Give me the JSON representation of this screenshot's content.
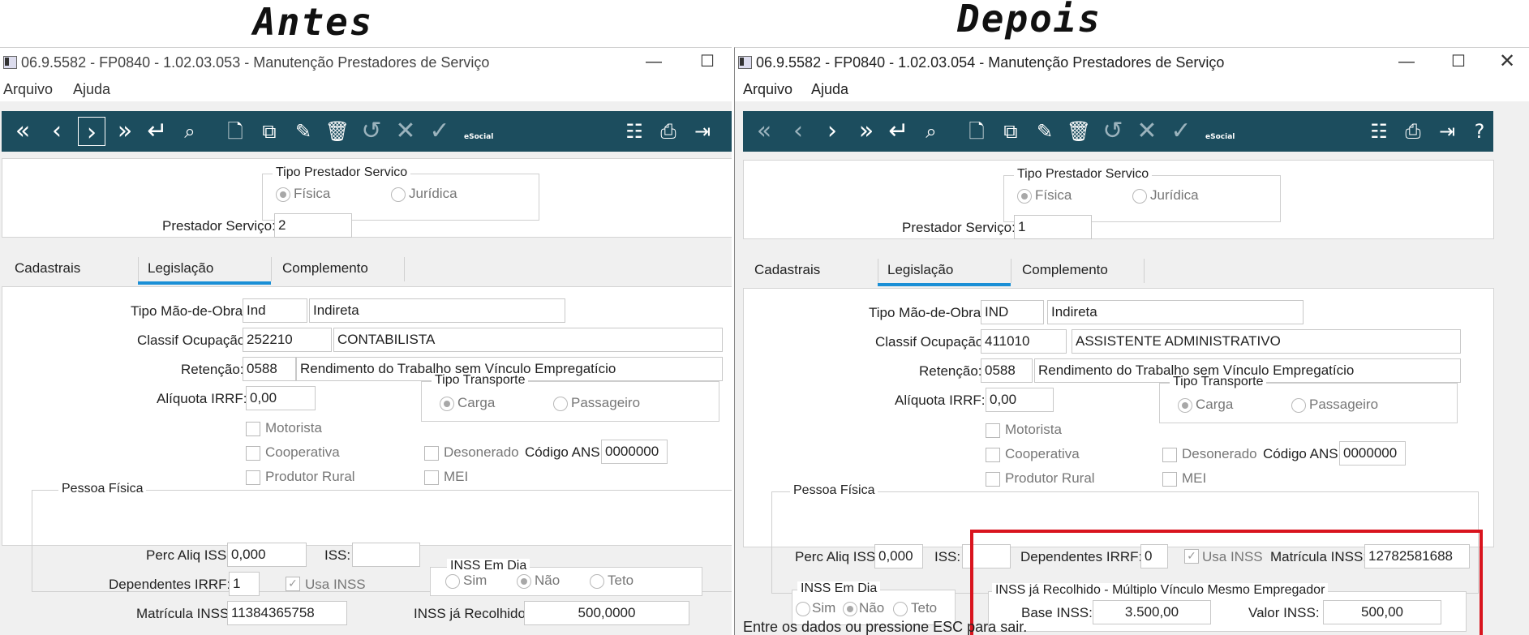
{
  "headings": {
    "before": "Antes",
    "after": "Depois"
  },
  "left": {
    "title": "06.9.5582 - FP0840 - 1.02.03.053 - Manutenção Prestadores de Serviço",
    "menu": [
      "Arquivo",
      "Ajuda"
    ],
    "tipo_prestador": {
      "legend": "Tipo Prestador Servico",
      "options": [
        "Física",
        "Jurídica"
      ],
      "selected": "Física"
    },
    "prestador_label": "Prestador Serviço:",
    "prestador_value": "2",
    "tabs": [
      "Cadastrais",
      "Legislação",
      "Complemento"
    ],
    "active_tab": "Legislação",
    "tipo_mao_obra_label": "Tipo Mão-de-Obra:",
    "tipo_mao_obra_code": "Ind",
    "tipo_mao_obra_desc": "Indireta",
    "classif_label": "Classif Ocupação:",
    "classif_code": "252210",
    "classif_desc": "CONTABILISTA",
    "retencao_label": "Retenção:",
    "retencao_code": "0588",
    "retencao_desc": "Rendimento do Trabalho sem Vínculo Empregatício",
    "aliquota_label": "Alíquota IRRF:",
    "aliquota_value": "0,00",
    "checks": {
      "motorista": "Motorista",
      "cooperativa": "Cooperativa",
      "produtor": "Produtor Rural",
      "desonerado": "Desonerado",
      "mei": "MEI"
    },
    "tipo_transporte": {
      "legend": "Tipo Transporte",
      "options": [
        "Carga",
        "Passageiro"
      ],
      "selected": "Carga"
    },
    "codigo_ans_label": "Código ANS:",
    "codigo_ans_value": "0000000",
    "pessoa_fisica": {
      "legend": "Pessoa Física",
      "perc_label": "Perc Aliq ISS:",
      "perc_value": "0,000",
      "iss_label": "ISS:",
      "iss_value": "",
      "dependentes_label": "Dependentes IRRF:",
      "dependentes_value": "1",
      "usa_inss_label": "Usa INSS",
      "matricula_label": "Matrícula INSS:",
      "matricula_value": "11384365758",
      "inss_em_dia": {
        "legend": "INSS Em Dia",
        "options": [
          "Sim",
          "Não",
          "Teto"
        ],
        "selected": "Não"
      },
      "inss_recolhido_label": "INSS já Recolhido:",
      "inss_recolhido_value": "500,0000"
    }
  },
  "right": {
    "title": "06.9.5582 - FP0840 - 1.02.03.054 - Manutenção Prestadores de Serviço",
    "menu": [
      "Arquivo",
      "Ajuda"
    ],
    "tipo_prestador": {
      "legend": "Tipo Prestador Servico",
      "options": [
        "Física",
        "Jurídica"
      ],
      "selected": "Física"
    },
    "prestador_label": "Prestador Serviço:",
    "prestador_value": "1",
    "tabs": [
      "Cadastrais",
      "Legislação",
      "Complemento"
    ],
    "active_tab": "Legislação",
    "tipo_mao_obra_label": "Tipo Mão-de-Obra:",
    "tipo_mao_obra_code": "IND",
    "tipo_mao_obra_desc": "Indireta",
    "classif_label": "Classif Ocupação:",
    "classif_code": "411010",
    "classif_desc": "ASSISTENTE ADMINISTRATIVO",
    "retencao_label": "Retenção:",
    "retencao_code": "0588",
    "retencao_desc": "Rendimento do Trabalho sem Vínculo Empregatício",
    "aliquota_label": "Alíquota IRRF:",
    "aliquota_value": "0,00",
    "checks": {
      "motorista": "Motorista",
      "cooperativa": "Cooperativa",
      "produtor": "Produtor Rural",
      "desonerado": "Desonerado",
      "mei": "MEI"
    },
    "tipo_transporte": {
      "legend": "Tipo Transporte",
      "options": [
        "Carga",
        "Passageiro"
      ],
      "selected": "Carga"
    },
    "codigo_ans_label": "Código ANS:",
    "codigo_ans_value": "0000000",
    "pessoa_fisica": {
      "legend": "Pessoa Física",
      "perc_label": "Perc Aliq ISS:",
      "perc_value": "0,000",
      "iss_label": "ISS:",
      "iss_value": "",
      "dependentes_label": "Dependentes IRRF:",
      "dependentes_value": "0",
      "usa_inss_label": "Usa INSS",
      "matricula_label": "Matrícula INSS:",
      "matricula_value": "12782581688",
      "inss_em_dia": {
        "legend": "INSS Em Dia",
        "options": [
          "Sim",
          "Não",
          "Teto"
        ],
        "selected": "Não"
      },
      "multiplo": {
        "legend": "INSS já Recolhido - Múltiplo Vínculo Mesmo Empregador",
        "base_label": "Base INSS:",
        "base_value": "3.500,00",
        "valor_label": "Valor INSS:",
        "valor_value": "500,00"
      }
    },
    "status": "Entre os dados ou pressione ESC para sair."
  },
  "toolbar_icons": [
    "first-icon",
    "prev-icon",
    "next-icon",
    "last-icon",
    "enter-icon",
    "search-icon",
    "new-icon",
    "copy-icon",
    "edit-icon",
    "delete-icon",
    "undo-icon",
    "cancel-icon",
    "confirm-icon",
    "esocial-icon",
    "tree-icon",
    "print-icon",
    "exit-icon",
    "help-icon"
  ],
  "toolbar_esocial_label": "eSocial"
}
